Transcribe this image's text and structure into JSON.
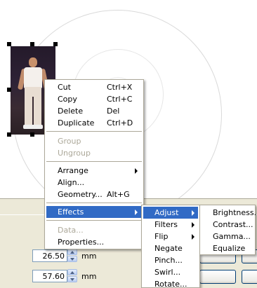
{
  "context_menu": {
    "items": [
      {
        "label": "Cut",
        "shortcut": "Ctrl+X"
      },
      {
        "label": "Copy",
        "shortcut": "Ctrl+C"
      },
      {
        "label": "Delete",
        "shortcut": "Del"
      },
      {
        "label": "Duplicate",
        "shortcut": "Ctrl+D"
      },
      {
        "label": "Group"
      },
      {
        "label": "Ungroup"
      },
      {
        "label": "Arrange"
      },
      {
        "label": "Align..."
      },
      {
        "label": "Geometry...",
        "shortcut": "Alt+G"
      },
      {
        "label": "Effects"
      },
      {
        "label": "Data..."
      },
      {
        "label": "Properties..."
      }
    ]
  },
  "effects_menu": {
    "items": [
      {
        "label": "Adjust"
      },
      {
        "label": "Filters"
      },
      {
        "label": "Flip"
      },
      {
        "label": "Negate"
      },
      {
        "label": "Pinch..."
      },
      {
        "label": "Swirl..."
      },
      {
        "label": "Rotate..."
      }
    ]
  },
  "adjust_menu": {
    "items": [
      {
        "label": "Brightness..."
      },
      {
        "label": "Contrast..."
      },
      {
        "label": "Gamma..."
      },
      {
        "label": "Equalize"
      }
    ]
  },
  "dialog": {
    "field1_value": "26.50",
    "field2_value": "57.60",
    "unit": "mm"
  },
  "colors": {
    "menu_highlight": "#316ac5",
    "dialog_face": "#ece9d8",
    "disabled_text": "#aca899"
  }
}
